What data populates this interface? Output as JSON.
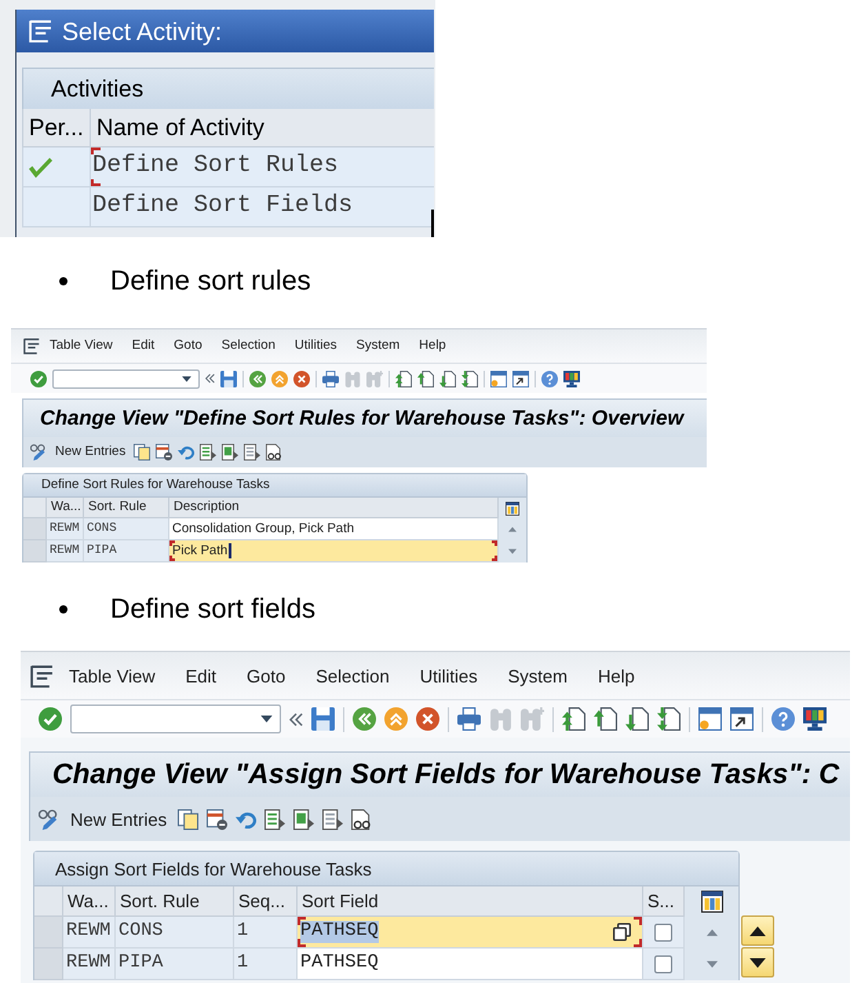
{
  "document": [
    {
      "kind": "activity_dialog",
      "title": "Select Activity:",
      "section": "Activities",
      "columns": [
        "Per...",
        "Name of Activity"
      ],
      "rows": [
        {
          "performed": true,
          "name": "Define Sort Rules",
          "focused": true
        },
        {
          "performed": false,
          "name": "Define Sort Fields",
          "focused": false
        }
      ]
    },
    {
      "kind": "bullet",
      "text": "Define sort rules"
    },
    {
      "kind": "sap_screen",
      "menu": [
        "Table View",
        "Edit",
        "Goto",
        "Selection",
        "Utilities",
        "System",
        "Help"
      ],
      "toolbar": [
        [
          {
            "kind": "enter",
            "disabled": false
          },
          {
            "kind": "command_field"
          },
          {
            "kind": "collapse",
            "disabled": false
          },
          {
            "kind": "save",
            "disabled": false
          }
        ],
        [
          {
            "kind": "back",
            "disabled": false
          },
          {
            "kind": "exit",
            "disabled": false
          },
          {
            "kind": "cancel",
            "disabled": false
          }
        ],
        [
          {
            "kind": "print",
            "disabled": false
          },
          {
            "kind": "find",
            "disabled": true
          },
          {
            "kind": "find_next",
            "disabled": true
          }
        ],
        [
          {
            "kind": "first_page",
            "disabled": false
          },
          {
            "kind": "previous_page",
            "disabled": false
          },
          {
            "kind": "next_page",
            "disabled": false
          },
          {
            "kind": "last_page",
            "disabled": false
          }
        ],
        [
          {
            "kind": "new_session",
            "disabled": false
          },
          {
            "kind": "shortcut",
            "disabled": false
          }
        ],
        [
          {
            "kind": "help",
            "disabled": false
          },
          {
            "kind": "layout",
            "disabled": false
          }
        ]
      ],
      "title": "Change View \"Define Sort Rules for Warehouse Tasks\": Overview",
      "app_toolbar": [
        {
          "kind": "display_change"
        },
        {
          "kind": "button",
          "label": "New Entries"
        },
        {
          "kind": "copy"
        },
        {
          "kind": "delete"
        },
        {
          "kind": "undo"
        },
        {
          "kind": "select_all"
        },
        {
          "kind": "select_block"
        },
        {
          "kind": "deselect_all"
        },
        {
          "kind": "print_preview"
        }
      ],
      "table": {
        "caption": "Define Sort Rules for Warehouse Tasks",
        "columns": [
          {
            "label": "Wa...",
            "kind": "key"
          },
          {
            "label": "Sort. Rule",
            "kind": "key"
          },
          {
            "label": "Description",
            "kind": "text"
          }
        ],
        "rows": [
          {
            "selected": false,
            "cells": [
              {
                "text": "REWM"
              },
              {
                "text": "CONS"
              },
              {
                "text": "Consolidation Group, Pick Path",
                "focused": false,
                "cursor": false
              }
            ]
          },
          {
            "selected": false,
            "cells": [
              {
                "text": "REWM"
              },
              {
                "text": "PIPA"
              },
              {
                "text": "Pick Path",
                "focused": true,
                "cursor": true
              }
            ]
          }
        ]
      }
    },
    {
      "kind": "bullet",
      "text": "Define sort fields"
    },
    {
      "kind": "sap_screen",
      "menu": [
        "Table View",
        "Edit",
        "Goto",
        "Selection",
        "Utilities",
        "System",
        "Help"
      ],
      "toolbar": [
        [
          {
            "kind": "enter",
            "disabled": false
          },
          {
            "kind": "command_field"
          },
          {
            "kind": "collapse",
            "disabled": false
          },
          {
            "kind": "save",
            "disabled": false
          }
        ],
        [
          {
            "kind": "back",
            "disabled": false
          },
          {
            "kind": "exit",
            "disabled": false
          },
          {
            "kind": "cancel",
            "disabled": false
          }
        ],
        [
          {
            "kind": "print",
            "disabled": false
          },
          {
            "kind": "find",
            "disabled": true
          },
          {
            "kind": "find_next",
            "disabled": true
          }
        ],
        [
          {
            "kind": "first_page",
            "disabled": false
          },
          {
            "kind": "previous_page",
            "disabled": false
          },
          {
            "kind": "next_page",
            "disabled": false
          },
          {
            "kind": "last_page",
            "disabled": false
          }
        ],
        [
          {
            "kind": "new_session",
            "disabled": false
          },
          {
            "kind": "shortcut",
            "disabled": false
          }
        ],
        [
          {
            "kind": "help",
            "disabled": false
          },
          {
            "kind": "layout",
            "disabled": false
          }
        ]
      ],
      "title": "Change View \"Assign Sort Fields for Warehouse Tasks\": C",
      "app_toolbar": [
        {
          "kind": "display_change"
        },
        {
          "kind": "button",
          "label": "New Entries"
        },
        {
          "kind": "copy"
        },
        {
          "kind": "delete"
        },
        {
          "kind": "undo"
        },
        {
          "kind": "select_all"
        },
        {
          "kind": "select_block"
        },
        {
          "kind": "deselect_all"
        },
        {
          "kind": "print_preview"
        }
      ],
      "table": {
        "caption": "Assign Sort Fields for Warehouse Tasks",
        "columns": [
          {
            "label": "Wa...",
            "kind": "key"
          },
          {
            "label": "Sort. Rule",
            "kind": "key"
          },
          {
            "label": "Seq...",
            "kind": "key"
          },
          {
            "label": "Sort Field",
            "kind": "field"
          },
          {
            "label": "S...",
            "kind": "checkbox"
          }
        ],
        "rows": [
          {
            "selected": false,
            "cells": [
              {
                "text": "REWM"
              },
              {
                "text": "CONS"
              },
              {
                "text": "1"
              },
              {
                "text": "PATHSEQ",
                "focused": true,
                "highlighted": true,
                "value_help": true
              },
              {
                "checked": false
              }
            ]
          },
          {
            "selected": false,
            "cells": [
              {
                "text": "REWM"
              },
              {
                "text": "PIPA"
              },
              {
                "text": "1"
              },
              {
                "text": "PATHSEQ",
                "focused": false,
                "highlighted": false,
                "value_help": false
              },
              {
                "checked": false
              }
            ]
          }
        ]
      },
      "scroll_buttons": [
        {
          "kind": "up"
        },
        {
          "kind": "down"
        }
      ]
    }
  ]
}
